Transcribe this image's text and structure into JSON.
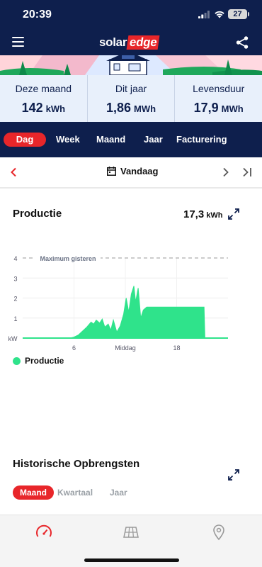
{
  "status": {
    "time": "20:39",
    "battery": "27"
  },
  "brand": {
    "solar": "solar",
    "edge": "edge",
    "accent": "#e8262a",
    "navy": "#0e1f4d"
  },
  "stats": [
    {
      "label": "Deze maand",
      "value": "142",
      "unit": "kWh"
    },
    {
      "label": "Dit jaar",
      "value": "1,86",
      "unit": "MWh"
    },
    {
      "label": "Levensduur",
      "value": "17,9",
      "unit": "MWh"
    }
  ],
  "tabs": [
    {
      "label": "Dag",
      "active": true
    },
    {
      "label": "Week"
    },
    {
      "label": "Maand"
    },
    {
      "label": "Jaar"
    },
    {
      "label": "Facturering"
    }
  ],
  "date_nav": {
    "label": "Vandaag"
  },
  "production": {
    "title": "Productie",
    "total": "17,3",
    "unit": "kWh"
  },
  "chart_data": {
    "type": "area",
    "ylabel": "kW",
    "yticks": [
      "1",
      "2",
      "3",
      "4"
    ],
    "xticks": [
      "6",
      "Middag",
      "18"
    ],
    "ylim": [
      0,
      4
    ],
    "xlim": [
      0,
      24
    ],
    "reference_line": {
      "label": "Maximum gisteren",
      "value": 4
    },
    "series": [
      {
        "name": "Productie",
        "color": "#2fe38b",
        "x": [
          0,
          5.5,
          6,
          6.5,
          7,
          7.5,
          8,
          8.3,
          8.6,
          9,
          9.3,
          9.6,
          10,
          10.3,
          10.6,
          11,
          11.4,
          11.8,
          12.1,
          12.4,
          12.7,
          13,
          13.2,
          13.5,
          13.8,
          14.1,
          14.5,
          15,
          15.5,
          16,
          17,
          18,
          19,
          20,
          21.2,
          21.3,
          24
        ],
        "y": [
          0,
          0,
          0.05,
          0.15,
          0.35,
          0.55,
          0.8,
          0.7,
          0.9,
          0.75,
          0.95,
          0.55,
          0.7,
          0.4,
          0.9,
          0.3,
          0.6,
          1.2,
          2.0,
          1.3,
          2.2,
          2.6,
          1.8,
          2.5,
          1.0,
          1.4,
          1.55,
          1.55,
          1.55,
          1.55,
          1.55,
          1.55,
          1.55,
          1.55,
          1.55,
          0,
          0
        ]
      }
    ],
    "grid": true
  },
  "legend": {
    "label": "Productie"
  },
  "historical": {
    "title": "Historische Opbrengsten",
    "tabs": [
      "Maand",
      "Kwartaal",
      "Jaar"
    ]
  },
  "nav_icons": [
    "gauge-icon",
    "solar-panel-icon",
    "location-pin-icon"
  ]
}
